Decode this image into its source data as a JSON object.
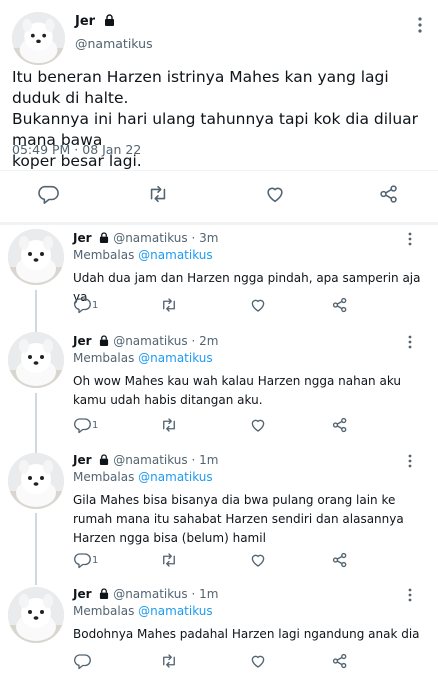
{
  "main_tweet": {
    "display_name": "Jer",
    "handle": "@namatikus",
    "text": "Itu beneran Harzen istrinya Mahes kan yang lagi duduk di halte.\nBukannya ini hari ulang tahunnya tapi kok dia diluar mana bawa\nkoper besar lagi.",
    "timestamp": "05:49 PM · 08 Jan 22",
    "icons": [
      "reply-icon",
      "retweet-icon",
      "like-icon",
      "share-icon"
    ]
  },
  "replies": [
    {
      "display_name": "Jer",
      "handle": "@namatikus",
      "time": "· 3m",
      "replying_to_label": "Membalas",
      "replying_to_handle": "@namatikus",
      "text": "Udah dua  jam dan Harzen ngga pindah,  apa samperin aja ya",
      "reply_count": "1"
    },
    {
      "display_name": "Jer",
      "handle": "@namatikus",
      "time": "· 2m",
      "replying_to_label": "Membalas",
      "replying_to_handle": "@namatikus",
      "text": "Oh wow Mahes kau wah kalau Harzen ngga nahan aku kamu udah habis ditangan aku.",
      "reply_count": "1"
    },
    {
      "display_name": "Jer",
      "handle": "@namatikus",
      "time": "· 1m",
      "replying_to_label": "Membalas",
      "replying_to_handle": "@namatikus",
      "text": "Gila Mahes bisa bisanya dia bwa pulang orang lain ke rumah mana itu sahabat Harzen sendiri dan alasannya Harzen ngga bisa (belum) hamil",
      "reply_count": "1"
    },
    {
      "display_name": "Jer",
      "handle": "@namatikus",
      "time": "· 1m",
      "replying_to_label": "Membalas",
      "replying_to_handle": "@namatikus",
      "text": "Bodohnya Mahes padahal Harzen lagi ngandung anak dia",
      "reply_count": ""
    }
  ],
  "colors": {
    "link": "#1d9bf0",
    "secondary_text": "#536471",
    "divider": "#eff3f4"
  }
}
